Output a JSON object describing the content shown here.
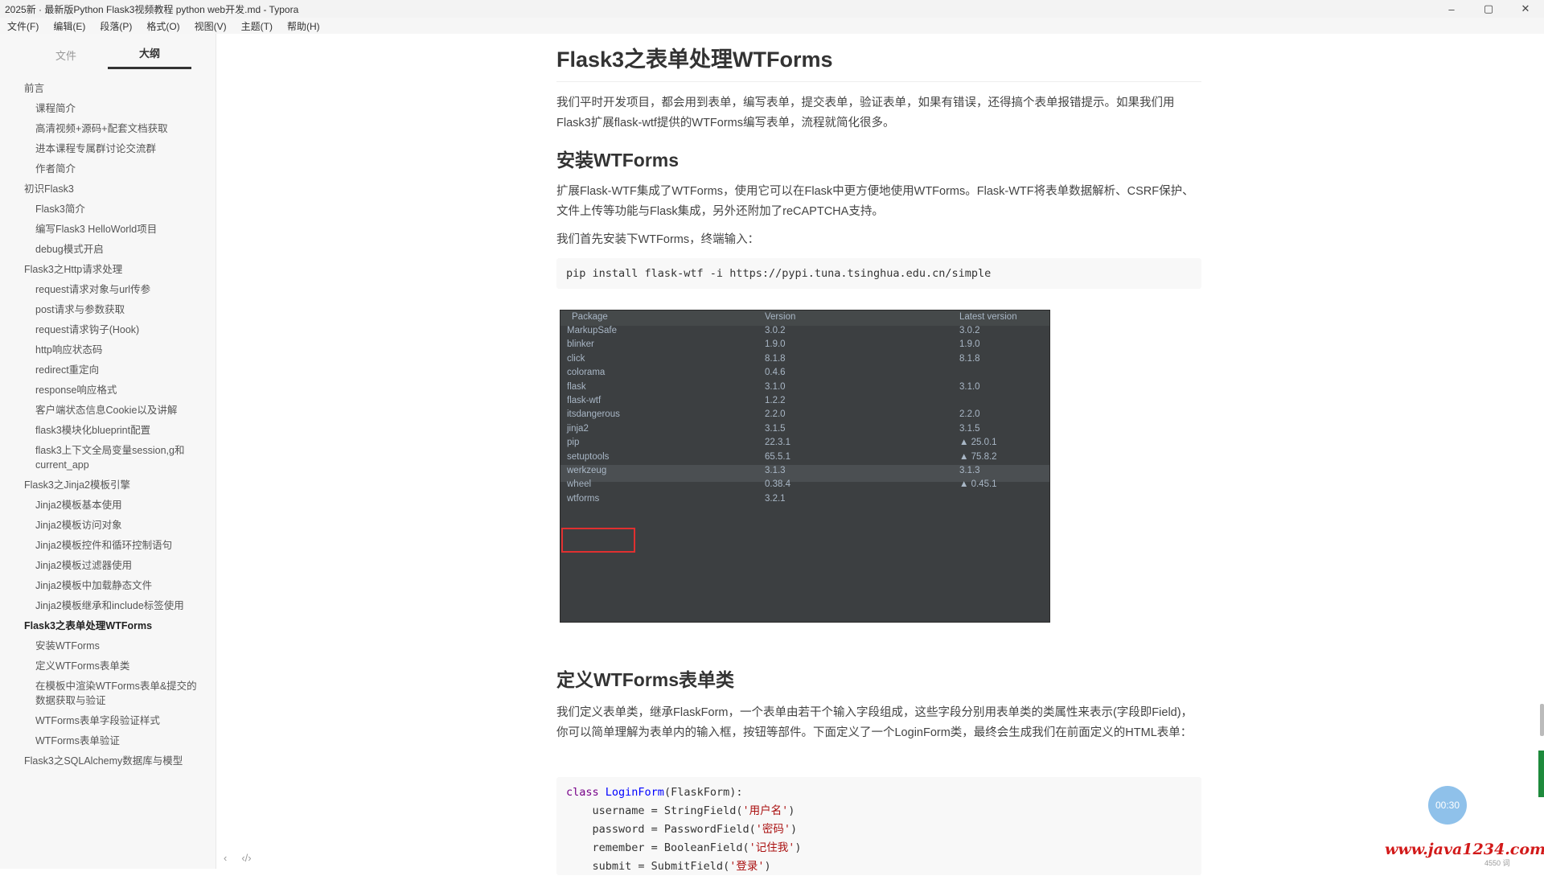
{
  "titlebar": {
    "title": "2025新 · 最新版Python Flask3视频教程 python web开发.md - Typora",
    "minimize": "–",
    "maximize": "▢",
    "close": "✕"
  },
  "menubar": [
    "文件(F)",
    "编辑(E)",
    "段落(P)",
    "格式(O)",
    "视图(V)",
    "主题(T)",
    "帮助(H)"
  ],
  "sidebar": {
    "tabs": [
      "文件",
      "大纲"
    ],
    "active_tab": "大纲",
    "outline": [
      {
        "label": "前言",
        "level": 1
      },
      {
        "label": "课程简介",
        "level": 2
      },
      {
        "label": "高清视频+源码+配套文档获取",
        "level": 2
      },
      {
        "label": "进本课程专属群讨论交流群",
        "level": 2
      },
      {
        "label": "作者简介",
        "level": 2
      },
      {
        "label": "初识Flask3",
        "level": 1
      },
      {
        "label": "Flask3简介",
        "level": 2
      },
      {
        "label": "编写Flask3 HelloWorld项目",
        "level": 2
      },
      {
        "label": "debug模式开启",
        "level": 2
      },
      {
        "label": "Flask3之Http请求处理",
        "level": 1
      },
      {
        "label": "request请求对象与url传参",
        "level": 2
      },
      {
        "label": "post请求与参数获取",
        "level": 2
      },
      {
        "label": "request请求钩子(Hook)",
        "level": 2
      },
      {
        "label": "http响应状态码",
        "level": 2
      },
      {
        "label": "redirect重定向",
        "level": 2
      },
      {
        "label": "response响应格式",
        "level": 2
      },
      {
        "label": "客户端状态信息Cookie以及讲解",
        "level": 2
      },
      {
        "label": "flask3模块化blueprint配置",
        "level": 2
      },
      {
        "label": "flask3上下文全局变量session,g和current_app",
        "level": 2
      },
      {
        "label": "Flask3之Jinja2模板引擎",
        "level": 1
      },
      {
        "label": "Jinja2模板基本使用",
        "level": 2
      },
      {
        "label": "Jinja2模板访问对象",
        "level": 2
      },
      {
        "label": "Jinja2模板控件和循环控制语句",
        "level": 2
      },
      {
        "label": "Jinja2模板过滤器使用",
        "level": 2
      },
      {
        "label": "Jinja2模板中加载静态文件",
        "level": 2
      },
      {
        "label": "Jinja2模板继承和include标签使用",
        "level": 2
      },
      {
        "label": "Flask3之表单处理WTForms",
        "level": 1,
        "active": true
      },
      {
        "label": "安装WTForms",
        "level": 2
      },
      {
        "label": "定义WTForms表单类",
        "level": 2
      },
      {
        "label": "在模板中渲染WTForms表单&提交的数据获取与验证",
        "level": 2
      },
      {
        "label": "WTForms表单字段验证样式",
        "level": 2
      },
      {
        "label": "WTForms表单验证",
        "level": 2
      },
      {
        "label": "Flask3之SQLAlchemy数据库与模型",
        "level": 1
      }
    ],
    "footer_icons": [
      "chevron-left-icon",
      "code-icon"
    ]
  },
  "document": {
    "h1": "Flask3之表单处理WTForms",
    "intro": "我们平时开发项目，都会用到表单，编写表单，提交表单，验证表单，如果有错误，还得搞个表单报错提示。如果我们用Flask3扩展flask-wtf提供的WTForms编写表单，流程就简化很多。",
    "h2_install": "安装WTForms",
    "install_p1": "扩展Flask-WTF集成了WTForms，使用它可以在Flask中更方便地使用WTForms。Flask-WTF将表单数据解析、CSRF保护、文件上传等功能与Flask集成，另外还附加了reCAPTCHA支持。",
    "install_p2": "我们首先安装下WTForms，终端输入：",
    "install_cmd": "pip install flask-wtf -i https://pypi.tuna.tsinghua.edu.cn/simple",
    "packages": {
      "headers": [
        "Package",
        "Version",
        "Latest version"
      ],
      "rows": [
        [
          "MarkupSafe",
          "3.0.2",
          "3.0.2"
        ],
        [
          "blinker",
          "1.9.0",
          "1.9.0"
        ],
        [
          "click",
          "8.1.8",
          "8.1.8"
        ],
        [
          "colorama",
          "0.4.6",
          ""
        ],
        [
          "flask",
          "3.1.0",
          "3.1.0"
        ],
        [
          "flask-wtf",
          "1.2.2",
          ""
        ],
        [
          "itsdangerous",
          "2.2.0",
          "2.2.0"
        ],
        [
          "jinja2",
          "3.1.5",
          "3.1.5"
        ],
        [
          "pip",
          "22.3.1",
          "▲ 25.0.1"
        ],
        [
          "setuptools",
          "65.5.1",
          "▲ 75.8.2"
        ],
        [
          "werkzeug",
          "3.1.3",
          "3.1.3"
        ],
        [
          "wheel",
          "0.38.4",
          "▲ 0.45.1"
        ],
        [
          "wtforms",
          "3.2.1",
          ""
        ]
      ],
      "highlighted_row": "werkzeug",
      "boxed_row": "wtforms"
    },
    "h2_define": "定义WTForms表单类",
    "define_p": "我们定义表单类，继承FlaskForm，一个表单由若干个输入字段组成，这些字段分别用表单类的类属性来表示(字段即Field)，你可以简单理解为表单内的输入框，按钮等部件。下面定义了一个LoginForm类，最终会生成我们在前面定义的HTML表单：",
    "code": {
      "line1_kw": "class",
      "line1_name": "LoginForm",
      "line1_rest": "(FlaskForm):",
      "line2": "    username = StringField(",
      "line2_str": "'用户名'",
      "line3": "    password = PasswordField(",
      "line3_str": "'密码'",
      "line4": "    remember = BooleanField(",
      "line4_str": "'记住我'",
      "line5": "    submit = SubmitField(",
      "line5_str": "'登录'",
      "close": ")"
    }
  },
  "widgets": {
    "timer": "00:30",
    "watermark": "www.java1234.com",
    "wordcount": "4550 词"
  },
  "colors": {
    "red_box": "#e03030",
    "watermark": "#d21a1a",
    "timer_bg": "#8fc1ea",
    "terminal_bg": "#3c3f41"
  }
}
